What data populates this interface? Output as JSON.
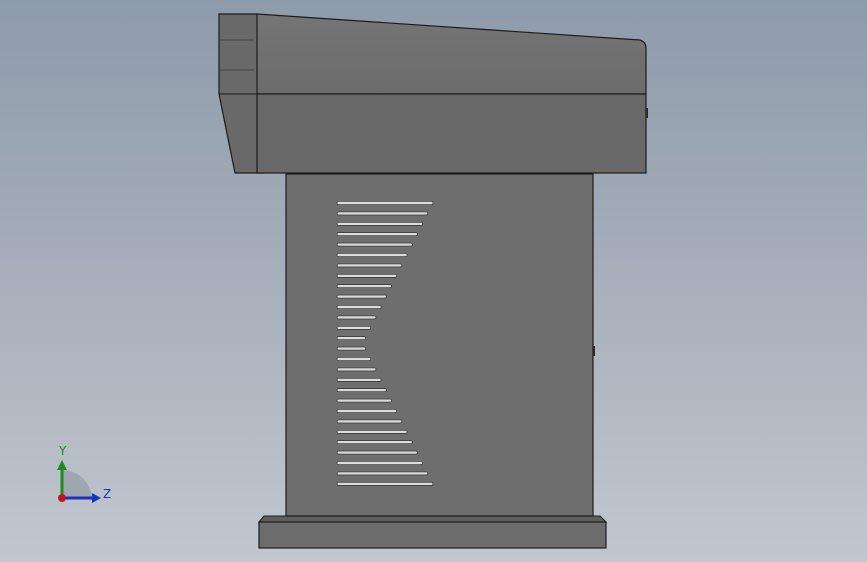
{
  "viewport": {
    "view": "Right view",
    "model_colors": {
      "body": "#6e6e6e",
      "head_top": "#717171",
      "head_side": "#696969",
      "edge": "#1c1c1c",
      "slot": "#d9d9d9",
      "base": "#6c6c6c"
    }
  },
  "triad": {
    "y_label": "Y",
    "z_label": "Z",
    "y_color": "#1f8a1f",
    "z_color": "#1f2fbf",
    "x_color": "#c01818"
  }
}
